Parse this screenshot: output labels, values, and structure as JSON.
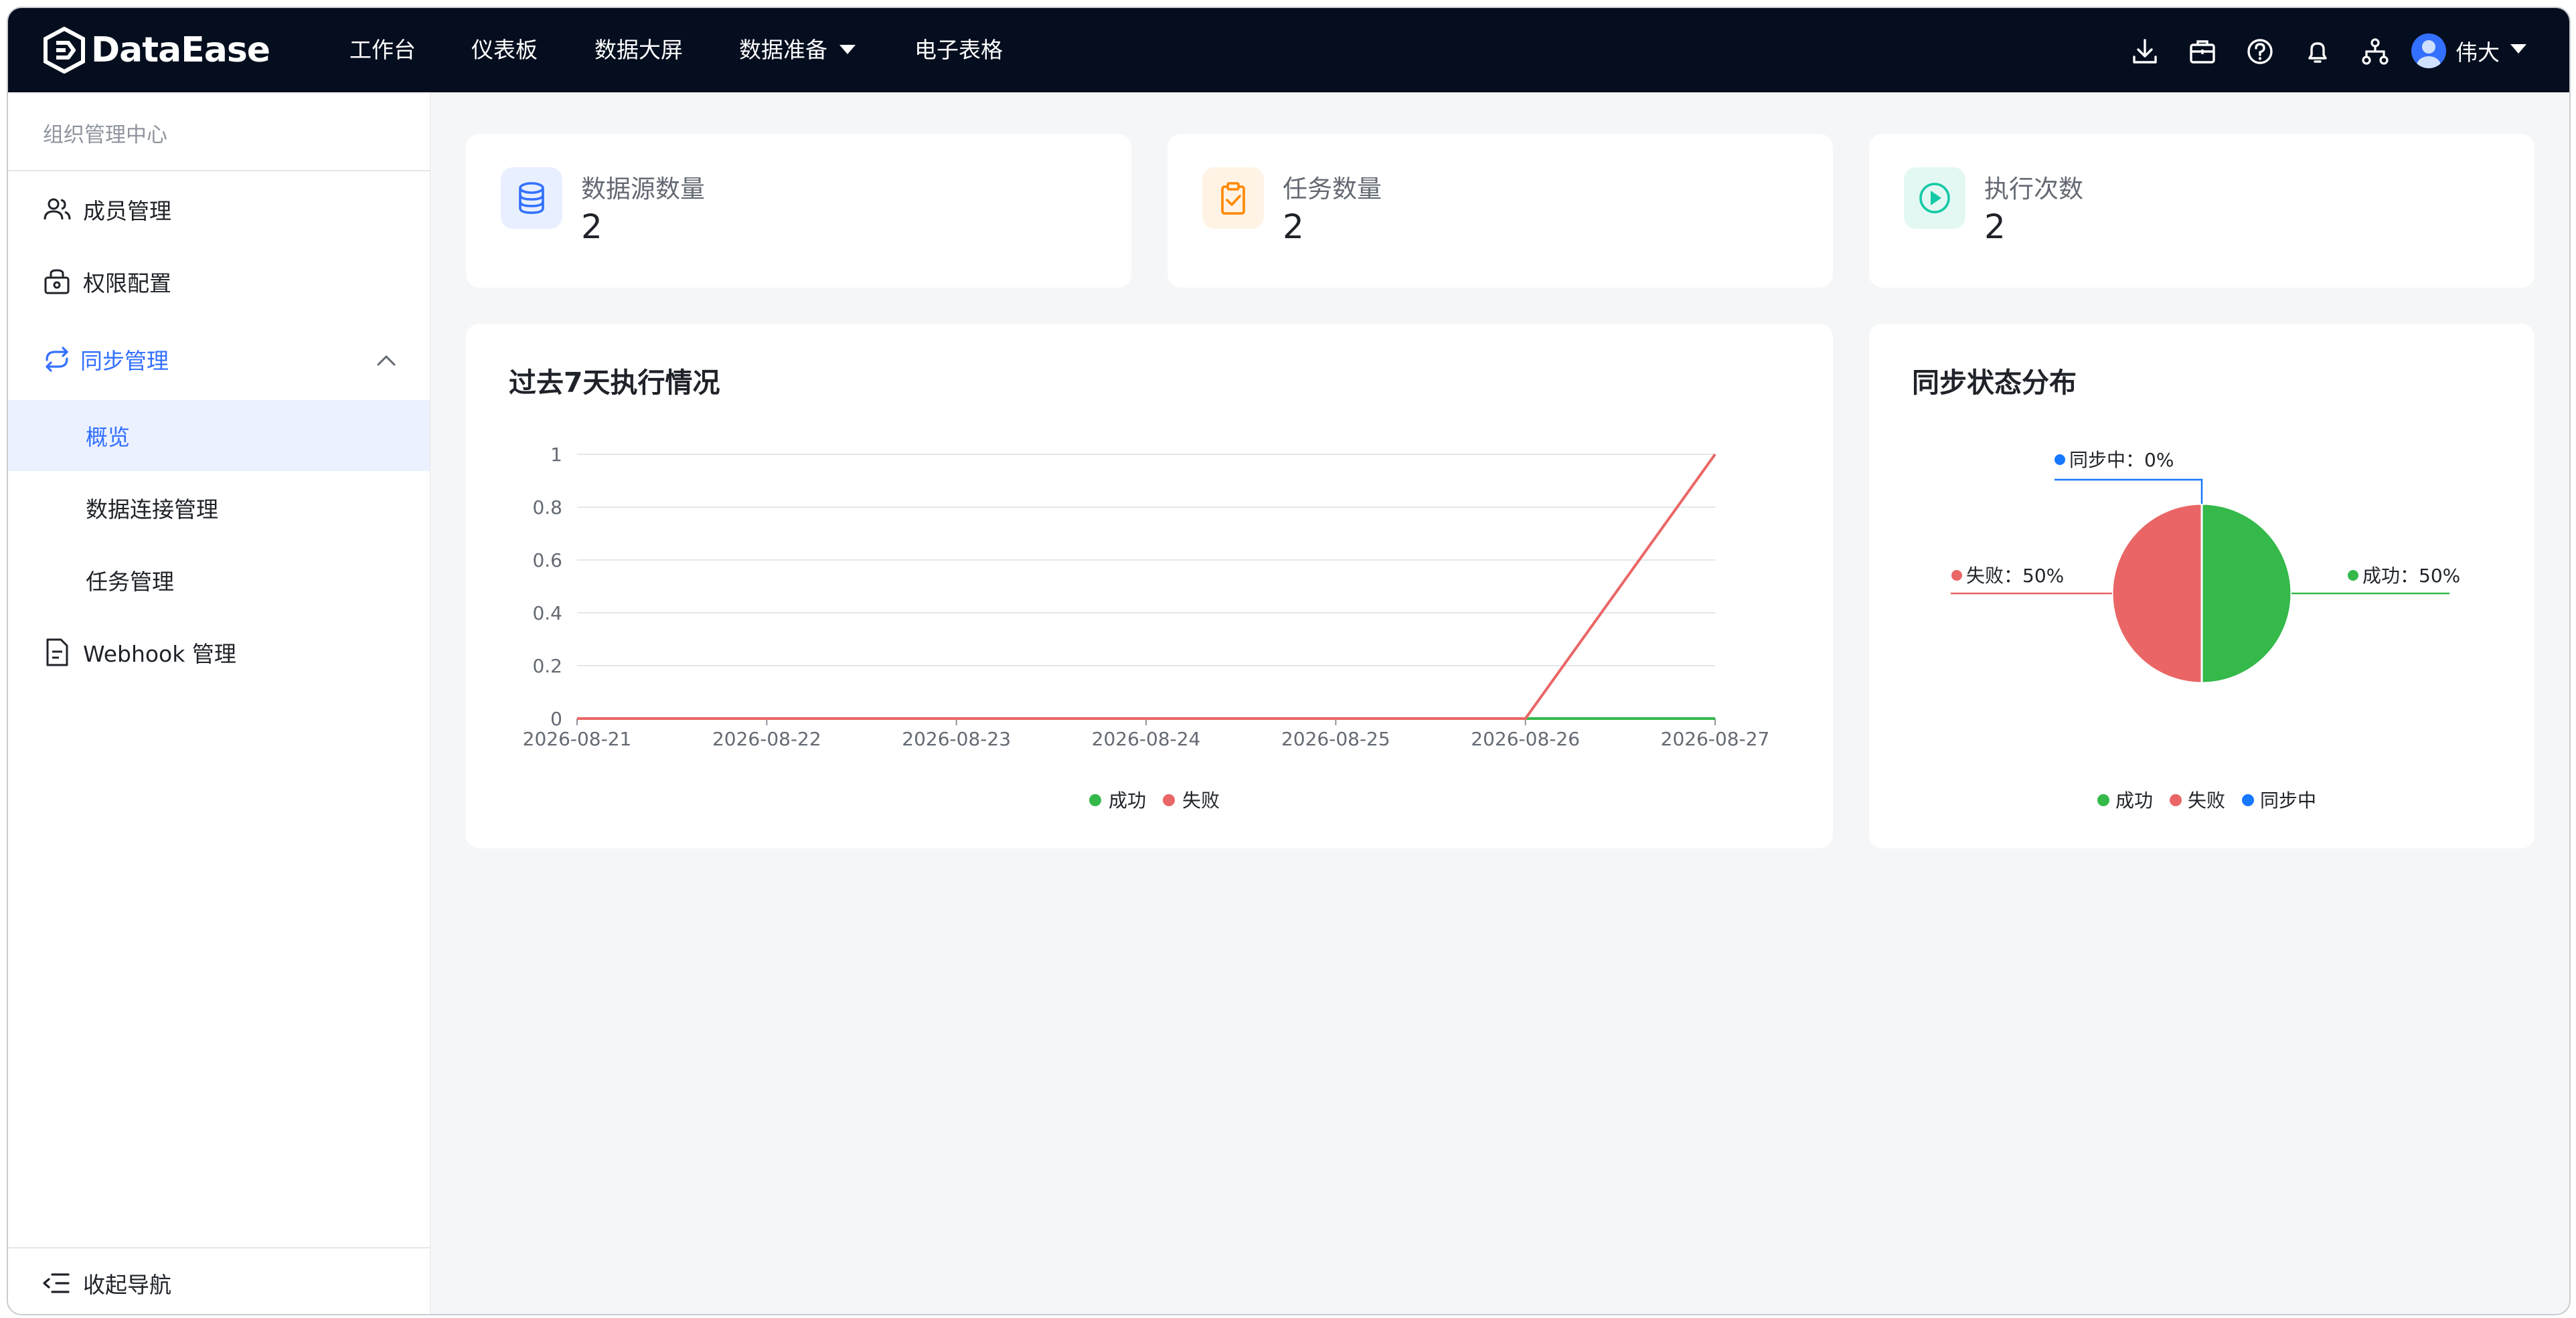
{
  "app": {
    "logo_text": "DataEase"
  },
  "nav": {
    "items": [
      {
        "label": "工作台"
      },
      {
        "label": "仪表板"
      },
      {
        "label": "数据大屏"
      },
      {
        "label": "数据准备"
      },
      {
        "label": "电子表格"
      }
    ],
    "user_name": "伟大"
  },
  "sidebar": {
    "title": "组织管理中心",
    "items": [
      {
        "label": "成员管理"
      },
      {
        "label": "权限配置"
      },
      {
        "label": "同步管理"
      },
      {
        "label": "Webhook 管理"
      }
    ],
    "sub_items": [
      {
        "label": "概览"
      },
      {
        "label": "数据连接管理"
      },
      {
        "label": "任务管理"
      }
    ],
    "collapse_label": "收起导航"
  },
  "stats": [
    {
      "label": "数据源数量",
      "value": "2"
    },
    {
      "label": "任务数量",
      "value": "2"
    },
    {
      "label": "执行次数",
      "value": "2"
    }
  ],
  "colors": {
    "success": "#34b94a",
    "fail": "#ea6666",
    "syncing": "#1677ff",
    "accent": "#3370ff",
    "nav_bg": "#050e1e"
  },
  "chart_data": [
    {
      "type": "line",
      "title": "过去7天执行情况",
      "x": [
        "2026-08-21",
        "2026-08-22",
        "2026-08-23",
        "2026-08-24",
        "2026-08-25",
        "2026-08-26",
        "2026-08-27"
      ],
      "series": [
        {
          "name": "成功",
          "values": [
            0,
            0,
            0,
            0,
            0,
            0,
            0
          ]
        },
        {
          "name": "失败",
          "values": [
            0,
            0,
            0,
            0,
            0,
            0,
            1
          ]
        }
      ],
      "ylim": [
        0,
        1
      ],
      "yticks": [
        "0",
        "0.2",
        "0.4",
        "0.6",
        "0.8",
        "1"
      ],
      "grid": true,
      "legend": "bottom-center"
    },
    {
      "type": "pie",
      "title": "同步状态分布",
      "slices": [
        {
          "name": "成功",
          "value": 50,
          "label": "成功：50%"
        },
        {
          "name": "失败",
          "value": 50,
          "label": "失败：50%"
        },
        {
          "name": "同步中",
          "value": 0,
          "label": "同步中：0%"
        }
      ],
      "legend": "bottom-center"
    }
  ]
}
